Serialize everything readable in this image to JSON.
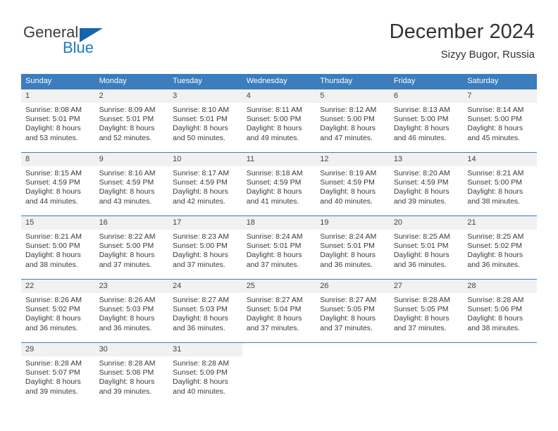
{
  "brand": {
    "name_part1": "General",
    "name_part2": "Blue",
    "triangle_icon": "triangle-icon",
    "colors": {
      "general_text": "#3c3c3c",
      "blue_text": "#1f7ac4",
      "triangle": "#1565a8"
    }
  },
  "header": {
    "title": "December 2024",
    "subtitle": "Sizyy Bugor, Russia"
  },
  "theme": {
    "header_row_bg": "#3b7dbd",
    "header_row_text": "#ffffff",
    "day_number_bg": "#f1f1f1",
    "cell_bg": "#ffffff",
    "row_divider": "#3b7dbd",
    "body_text": "#3a3a3a"
  },
  "calendar": {
    "weekday_headers": [
      "Sunday",
      "Monday",
      "Tuesday",
      "Wednesday",
      "Thursday",
      "Friday",
      "Saturday"
    ],
    "weeks": [
      [
        {
          "day": "1",
          "sunrise": "Sunrise: 8:08 AM",
          "sunset": "Sunset: 5:01 PM",
          "daylight_line1": "Daylight: 8 hours",
          "daylight_line2": "and 53 minutes."
        },
        {
          "day": "2",
          "sunrise": "Sunrise: 8:09 AM",
          "sunset": "Sunset: 5:01 PM",
          "daylight_line1": "Daylight: 8 hours",
          "daylight_line2": "and 52 minutes."
        },
        {
          "day": "3",
          "sunrise": "Sunrise: 8:10 AM",
          "sunset": "Sunset: 5:01 PM",
          "daylight_line1": "Daylight: 8 hours",
          "daylight_line2": "and 50 minutes."
        },
        {
          "day": "4",
          "sunrise": "Sunrise: 8:11 AM",
          "sunset": "Sunset: 5:00 PM",
          "daylight_line1": "Daylight: 8 hours",
          "daylight_line2": "and 49 minutes."
        },
        {
          "day": "5",
          "sunrise": "Sunrise: 8:12 AM",
          "sunset": "Sunset: 5:00 PM",
          "daylight_line1": "Daylight: 8 hours",
          "daylight_line2": "and 47 minutes."
        },
        {
          "day": "6",
          "sunrise": "Sunrise: 8:13 AM",
          "sunset": "Sunset: 5:00 PM",
          "daylight_line1": "Daylight: 8 hours",
          "daylight_line2": "and 46 minutes."
        },
        {
          "day": "7",
          "sunrise": "Sunrise: 8:14 AM",
          "sunset": "Sunset: 5:00 PM",
          "daylight_line1": "Daylight: 8 hours",
          "daylight_line2": "and 45 minutes."
        }
      ],
      [
        {
          "day": "8",
          "sunrise": "Sunrise: 8:15 AM",
          "sunset": "Sunset: 4:59 PM",
          "daylight_line1": "Daylight: 8 hours",
          "daylight_line2": "and 44 minutes."
        },
        {
          "day": "9",
          "sunrise": "Sunrise: 8:16 AM",
          "sunset": "Sunset: 4:59 PM",
          "daylight_line1": "Daylight: 8 hours",
          "daylight_line2": "and 43 minutes."
        },
        {
          "day": "10",
          "sunrise": "Sunrise: 8:17 AM",
          "sunset": "Sunset: 4:59 PM",
          "daylight_line1": "Daylight: 8 hours",
          "daylight_line2": "and 42 minutes."
        },
        {
          "day": "11",
          "sunrise": "Sunrise: 8:18 AM",
          "sunset": "Sunset: 4:59 PM",
          "daylight_line1": "Daylight: 8 hours",
          "daylight_line2": "and 41 minutes."
        },
        {
          "day": "12",
          "sunrise": "Sunrise: 8:19 AM",
          "sunset": "Sunset: 4:59 PM",
          "daylight_line1": "Daylight: 8 hours",
          "daylight_line2": "and 40 minutes."
        },
        {
          "day": "13",
          "sunrise": "Sunrise: 8:20 AM",
          "sunset": "Sunset: 4:59 PM",
          "daylight_line1": "Daylight: 8 hours",
          "daylight_line2": "and 39 minutes."
        },
        {
          "day": "14",
          "sunrise": "Sunrise: 8:21 AM",
          "sunset": "Sunset: 5:00 PM",
          "daylight_line1": "Daylight: 8 hours",
          "daylight_line2": "and 38 minutes."
        }
      ],
      [
        {
          "day": "15",
          "sunrise": "Sunrise: 8:21 AM",
          "sunset": "Sunset: 5:00 PM",
          "daylight_line1": "Daylight: 8 hours",
          "daylight_line2": "and 38 minutes."
        },
        {
          "day": "16",
          "sunrise": "Sunrise: 8:22 AM",
          "sunset": "Sunset: 5:00 PM",
          "daylight_line1": "Daylight: 8 hours",
          "daylight_line2": "and 37 minutes."
        },
        {
          "day": "17",
          "sunrise": "Sunrise: 8:23 AM",
          "sunset": "Sunset: 5:00 PM",
          "daylight_line1": "Daylight: 8 hours",
          "daylight_line2": "and 37 minutes."
        },
        {
          "day": "18",
          "sunrise": "Sunrise: 8:24 AM",
          "sunset": "Sunset: 5:01 PM",
          "daylight_line1": "Daylight: 8 hours",
          "daylight_line2": "and 37 minutes."
        },
        {
          "day": "19",
          "sunrise": "Sunrise: 8:24 AM",
          "sunset": "Sunset: 5:01 PM",
          "daylight_line1": "Daylight: 8 hours",
          "daylight_line2": "and 36 minutes."
        },
        {
          "day": "20",
          "sunrise": "Sunrise: 8:25 AM",
          "sunset": "Sunset: 5:01 PM",
          "daylight_line1": "Daylight: 8 hours",
          "daylight_line2": "and 36 minutes."
        },
        {
          "day": "21",
          "sunrise": "Sunrise: 8:25 AM",
          "sunset": "Sunset: 5:02 PM",
          "daylight_line1": "Daylight: 8 hours",
          "daylight_line2": "and 36 minutes."
        }
      ],
      [
        {
          "day": "22",
          "sunrise": "Sunrise: 8:26 AM",
          "sunset": "Sunset: 5:02 PM",
          "daylight_line1": "Daylight: 8 hours",
          "daylight_line2": "and 36 minutes."
        },
        {
          "day": "23",
          "sunrise": "Sunrise: 8:26 AM",
          "sunset": "Sunset: 5:03 PM",
          "daylight_line1": "Daylight: 8 hours",
          "daylight_line2": "and 36 minutes."
        },
        {
          "day": "24",
          "sunrise": "Sunrise: 8:27 AM",
          "sunset": "Sunset: 5:03 PM",
          "daylight_line1": "Daylight: 8 hours",
          "daylight_line2": "and 36 minutes."
        },
        {
          "day": "25",
          "sunrise": "Sunrise: 8:27 AM",
          "sunset": "Sunset: 5:04 PM",
          "daylight_line1": "Daylight: 8 hours",
          "daylight_line2": "and 37 minutes."
        },
        {
          "day": "26",
          "sunrise": "Sunrise: 8:27 AM",
          "sunset": "Sunset: 5:05 PM",
          "daylight_line1": "Daylight: 8 hours",
          "daylight_line2": "and 37 minutes."
        },
        {
          "day": "27",
          "sunrise": "Sunrise: 8:28 AM",
          "sunset": "Sunset: 5:05 PM",
          "daylight_line1": "Daylight: 8 hours",
          "daylight_line2": "and 37 minutes."
        },
        {
          "day": "28",
          "sunrise": "Sunrise: 8:28 AM",
          "sunset": "Sunset: 5:06 PM",
          "daylight_line1": "Daylight: 8 hours",
          "daylight_line2": "and 38 minutes."
        }
      ],
      [
        {
          "day": "29",
          "sunrise": "Sunrise: 8:28 AM",
          "sunset": "Sunset: 5:07 PM",
          "daylight_line1": "Daylight: 8 hours",
          "daylight_line2": "and 39 minutes."
        },
        {
          "day": "30",
          "sunrise": "Sunrise: 8:28 AM",
          "sunset": "Sunset: 5:08 PM",
          "daylight_line1": "Daylight: 8 hours",
          "daylight_line2": "and 39 minutes."
        },
        {
          "day": "31",
          "sunrise": "Sunrise: 8:28 AM",
          "sunset": "Sunset: 5:09 PM",
          "daylight_line1": "Daylight: 8 hours",
          "daylight_line2": "and 40 minutes."
        },
        {
          "day": "",
          "sunrise": "",
          "sunset": "",
          "daylight_line1": "",
          "daylight_line2": ""
        },
        {
          "day": "",
          "sunrise": "",
          "sunset": "",
          "daylight_line1": "",
          "daylight_line2": ""
        },
        {
          "day": "",
          "sunrise": "",
          "sunset": "",
          "daylight_line1": "",
          "daylight_line2": ""
        },
        {
          "day": "",
          "sunrise": "",
          "sunset": "",
          "daylight_line1": "",
          "daylight_line2": ""
        }
      ]
    ]
  }
}
